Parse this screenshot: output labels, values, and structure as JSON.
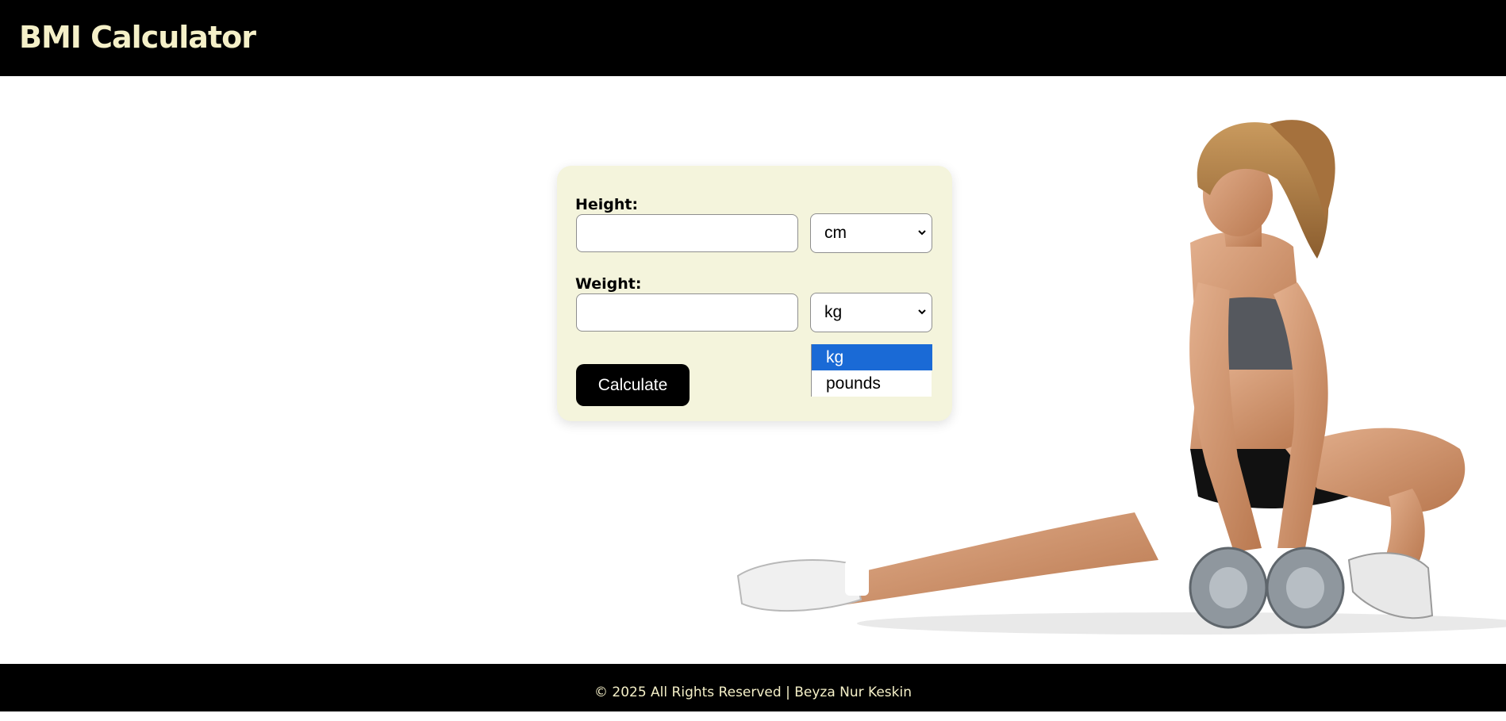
{
  "header": {
    "title": "BMI Calculator"
  },
  "form": {
    "height_label": "Height:",
    "height_value": "",
    "height_unit": "cm",
    "weight_label": "Weight:",
    "weight_value": "",
    "weight_unit": "kg",
    "weight_unit_options": [
      "kg",
      "pounds"
    ],
    "highlighted_option": "kg",
    "calculate_label": "Calculate"
  },
  "footer": {
    "text": "© 2025 All Rights Reserved | Beyza Nur Keskin"
  },
  "colors": {
    "header_bg": "#000000",
    "title_color": "#f5f0c8",
    "card_bg": "#f4f4dc",
    "button_bg": "#000000",
    "option_highlight": "#1a6ad6"
  }
}
